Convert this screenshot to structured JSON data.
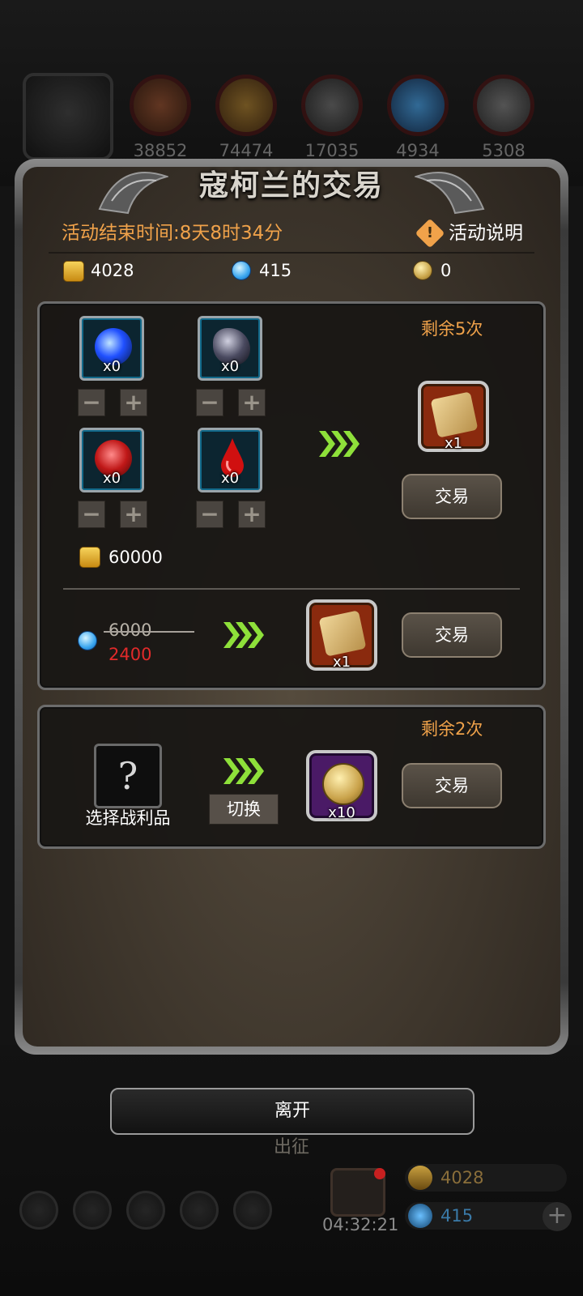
{
  "resources_top": [
    {
      "icon": "meat-icon",
      "amount": "38852"
    },
    {
      "icon": "wood-icon",
      "amount": "74474"
    },
    {
      "icon": "stone-icon",
      "amount": "17035"
    },
    {
      "icon": "crystal-icon",
      "amount": "4934"
    },
    {
      "icon": "iron-icon",
      "amount": "5308"
    }
  ],
  "dialog": {
    "title": "寇柯兰的交易",
    "end_time": "活动结束时间:8天8时34分",
    "info_label": "活动说明",
    "currencies": {
      "gold": "4028",
      "gems": "415",
      "medals": "0"
    }
  },
  "trade1": {
    "remaining": "剩余5次",
    "materials": [
      {
        "icon": "blue-orb-icon",
        "count": "x0"
      },
      {
        "icon": "dark-ore-icon",
        "count": "x0"
      },
      {
        "icon": "red-crystal-icon",
        "count": "x0"
      },
      {
        "icon": "blood-drop-icon",
        "count": "x0"
      }
    ],
    "reward_count": "x1",
    "gold_cost": "60000",
    "trade_label": "交易"
  },
  "trade2": {
    "old_price": "6000",
    "new_price": "2400",
    "reward_count": "x1",
    "trade_label": "交易"
  },
  "trade3": {
    "remaining": "剩余2次",
    "select_label": "选择战利品",
    "switch_label": "切换",
    "reward_count": "x10",
    "trade_label": "交易"
  },
  "leave_label": "离开",
  "bottom": {
    "march_label": "出征",
    "timer": "04:32:21",
    "gold": "4028",
    "gems": "415"
  },
  "colors": {
    "accent_orange": "#f0a24a",
    "discount_red": "#e12a2a",
    "arrow_green": "#8ee03a"
  }
}
